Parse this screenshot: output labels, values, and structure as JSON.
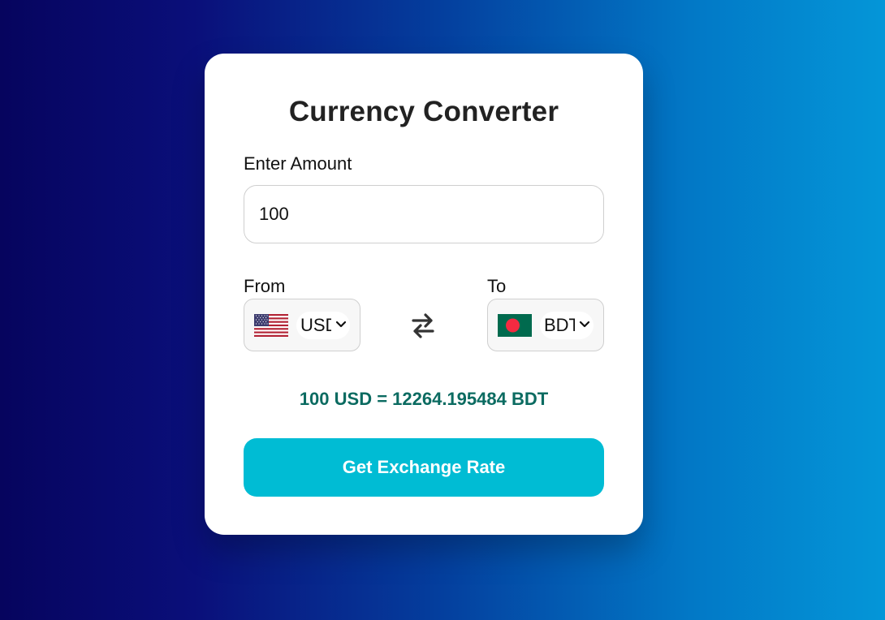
{
  "title": "Currency Converter",
  "amount": {
    "label": "Enter Amount",
    "value": "100"
  },
  "from": {
    "label": "From",
    "currency": "USD",
    "flag_icon": "us-flag-icon"
  },
  "to": {
    "label": "To",
    "currency": "BDT",
    "flag_icon": "bangladesh-flag-icon"
  },
  "swap_icon": "swap-arrows-icon",
  "result": "100 USD = 12264.195484 BDT",
  "button_label": "Get Exchange Rate",
  "colors": {
    "accent": "#00bcd4",
    "result_text": "#0b6b61",
    "background_start": "#06045e",
    "background_end": "#0496d8"
  }
}
